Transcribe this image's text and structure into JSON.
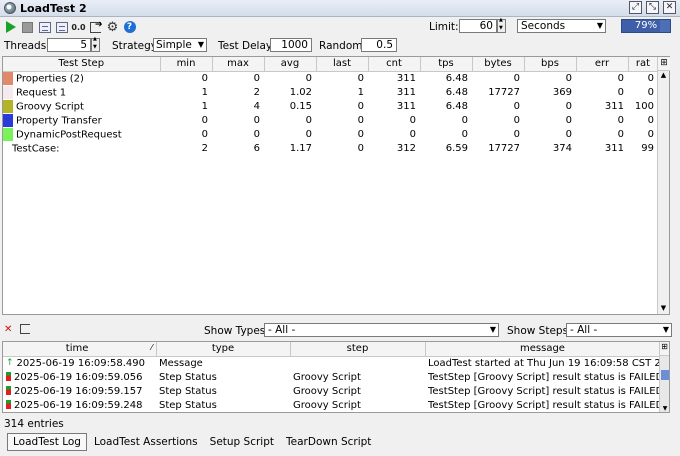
{
  "window": {
    "title": "LoadTest 2"
  },
  "toolbar": {
    "limit_label": "Limit:",
    "limit_value": "60",
    "limit_unit": "Seconds",
    "progress_text": "79%",
    "progress": 0.79
  },
  "settings": {
    "threads_label": "Threads:",
    "threads_value": "5",
    "strategy_label": "Strategy",
    "strategy_value": "Simple",
    "test_delay_label": "Test Delay",
    "test_delay_value": "1000",
    "random_label": "Random",
    "random_value": "0.5"
  },
  "stats": {
    "headers": [
      "Test Step",
      "min",
      "max",
      "avg",
      "last",
      "cnt",
      "tps",
      "bytes",
      "bps",
      "err",
      "rat"
    ],
    "rows": [
      {
        "color": "#e08a6a",
        "step": "Properties (2)",
        "min": "0",
        "max": "0",
        "avg": "0",
        "last": "0",
        "cnt": "311",
        "tps": "6.48",
        "bytes": "0",
        "bps": "0",
        "err": "0",
        "rat": "0"
      },
      {
        "color": "#f6e9ef",
        "step": "Request 1",
        "min": "1",
        "max": "2",
        "avg": "1.02",
        "last": "1",
        "cnt": "311",
        "tps": "6.48",
        "bytes": "17727",
        "bps": "369",
        "err": "0",
        "rat": "0"
      },
      {
        "color": "#b3b326",
        "step": "Groovy Script",
        "min": "1",
        "max": "4",
        "avg": "0.15",
        "last": "0",
        "cnt": "311",
        "tps": "6.48",
        "bytes": "0",
        "bps": "0",
        "err": "311",
        "rat": "100"
      },
      {
        "color": "#2a3ad8",
        "step": "Property Transfer",
        "min": "0",
        "max": "0",
        "avg": "0",
        "last": "0",
        "cnt": "0",
        "tps": "0",
        "bytes": "0",
        "bps": "0",
        "err": "0",
        "rat": "0"
      },
      {
        "color": "#7af25a",
        "step": "DynamicPostRequest",
        "min": "0",
        "max": "0",
        "avg": "0",
        "last": "0",
        "cnt": "0",
        "tps": "0",
        "bytes": "0",
        "bps": "0",
        "err": "0",
        "rat": "0"
      },
      {
        "color": "",
        "step": "TestCase:",
        "min": "2",
        "max": "6",
        "avg": "1.17",
        "last": "0",
        "cnt": "312",
        "tps": "6.59",
        "bytes": "17727",
        "bps": "374",
        "err": "311",
        "rat": "99"
      }
    ]
  },
  "logbar": {
    "show_types_label": "Show Types:",
    "show_types_value": "- All -",
    "show_steps_label": "Show Steps:",
    "show_steps_value": "- All -"
  },
  "log": {
    "headers": {
      "time": "time",
      "type": "type",
      "step": "step",
      "message": "message"
    },
    "rows": [
      {
        "status": "ok",
        "time": "2025-06-19 16:09:58.490",
        "type": "Message",
        "step": "",
        "message": "LoadTest started at Thu Jun 19 16:09:58 CST 2025"
      },
      {
        "status": "fail",
        "time": "2025-06-19 16:09:59.056",
        "type": "Step Status",
        "step": "Groovy Script",
        "message": "TestStep [Groovy Script] result status is FAILED; [gro..."
      },
      {
        "status": "fail",
        "time": "2025-06-19 16:09:59.157",
        "type": "Step Status",
        "step": "Groovy Script",
        "message": "TestStep [Groovy Script] result status is FAILED; [gro..."
      },
      {
        "status": "fail",
        "time": "2025-06-19 16:09:59.248",
        "type": "Step Status",
        "step": "Groovy Script",
        "message": "TestStep [Groovy Script] result status is FAILED; [gro..."
      }
    ],
    "entries": "314 entries"
  },
  "tabs": [
    "LoadTest Log",
    "LoadTest Assertions",
    "Setup Script",
    "TearDown Script"
  ]
}
